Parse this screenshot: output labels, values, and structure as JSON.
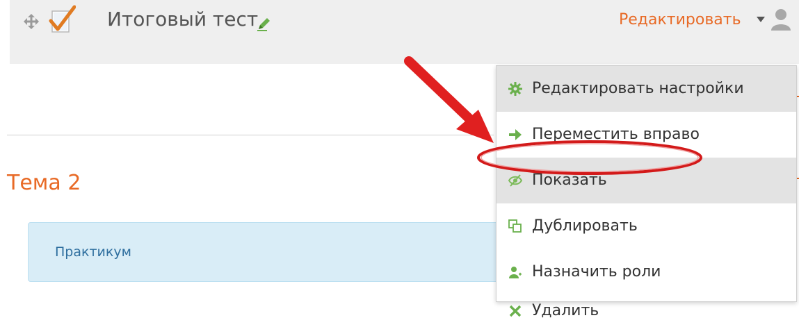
{
  "activity": {
    "name": "Итоговый тест",
    "edit_menu_label": "Редактировать",
    "icons": {
      "move": "move-arrows-icon",
      "quiz": "quiz-checkmark-icon",
      "pencil": "pencil-icon",
      "caret": "caret-down-icon",
      "roles": "user-role-icon"
    }
  },
  "section": {
    "title": "Тема 2",
    "practicum_label": "Практикум"
  },
  "dropdown": {
    "items": [
      {
        "label": "Редактировать настройки",
        "icon": "gear-icon",
        "highlighted": true
      },
      {
        "label": "Переместить вправо",
        "icon": "arrow-right-icon",
        "highlighted": false
      },
      {
        "label": "Показать",
        "icon": "eye-slash-icon",
        "highlighted": true
      },
      {
        "label": "Дублировать",
        "icon": "duplicate-icon",
        "highlighted": false
      },
      {
        "label": "Назначить роли",
        "icon": "assign-roles-icon",
        "highlighted": false
      },
      {
        "label": "Удалить",
        "icon": "delete-x-icon",
        "highlighted": false
      }
    ]
  },
  "annotation": {
    "arrow_color": "#e02020",
    "highlight_ellipse_color": "#d31a1a"
  },
  "colors": {
    "accent_orange": "#e86a26",
    "info_box_bg": "#d9edf7",
    "info_text": "#2f6f9f",
    "row_bg": "#efefef",
    "menu_highlight": "#e3e3e3"
  }
}
